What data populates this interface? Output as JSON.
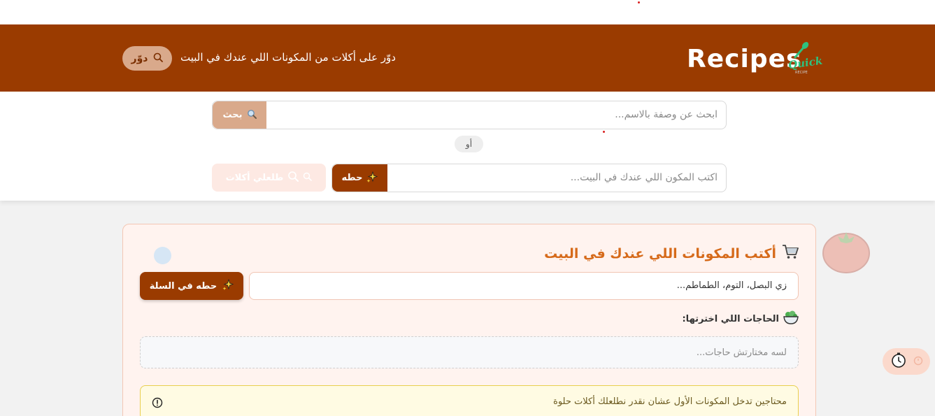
{
  "header": {
    "logo_text": "Recipes",
    "logo_badge": "Quick",
    "logo_badge_sub": "RECIPE",
    "tagline": "دوّر على أكلات من المكونات اللي عندك في البيت",
    "search_button_label": "دوّر"
  },
  "search": {
    "name_placeholder": "ابحث عن وصفة بالاسم...",
    "name_button_label": "بحث",
    "or_label": "أو",
    "ingredient_placeholder": "اكتب المكون اللي عندك في البيت...",
    "ingredient_button_label": "حطه",
    "find_meals_button_label": "طلعلي أكلات"
  },
  "panel": {
    "title": "أكتب المكونات اللي عندك في البيت",
    "input_placeholder": "زي البصل، التوم، الطماطم...",
    "add_button_label": "حطه في السلة",
    "chosen_label": "الحاجات اللي اخترتها:",
    "chosen_empty": "لسه مختارتش حاجات...",
    "warning_text": "محتاجين تدخل المكونات الأول عشان نقدر نطلعلك أكلات حلوة"
  },
  "icons": {
    "logo": "spoon-logo-icon",
    "search": "search-icon",
    "sparkles": "sparkles-icon",
    "cart": "shopping-cart-icon",
    "salad": "salad-bowl-icon",
    "info": "info-icon",
    "timer": "timer-icon",
    "tomato": "tomato-icon",
    "fries": "fries-icon"
  },
  "colors": {
    "brand": "#9a3b00",
    "accent": "#d66a1a",
    "muted_button": "#d9a98b",
    "panel_bg": "#fff3ef",
    "warning_bg": "#fffbe3",
    "warning_border": "#e8cf4f"
  }
}
